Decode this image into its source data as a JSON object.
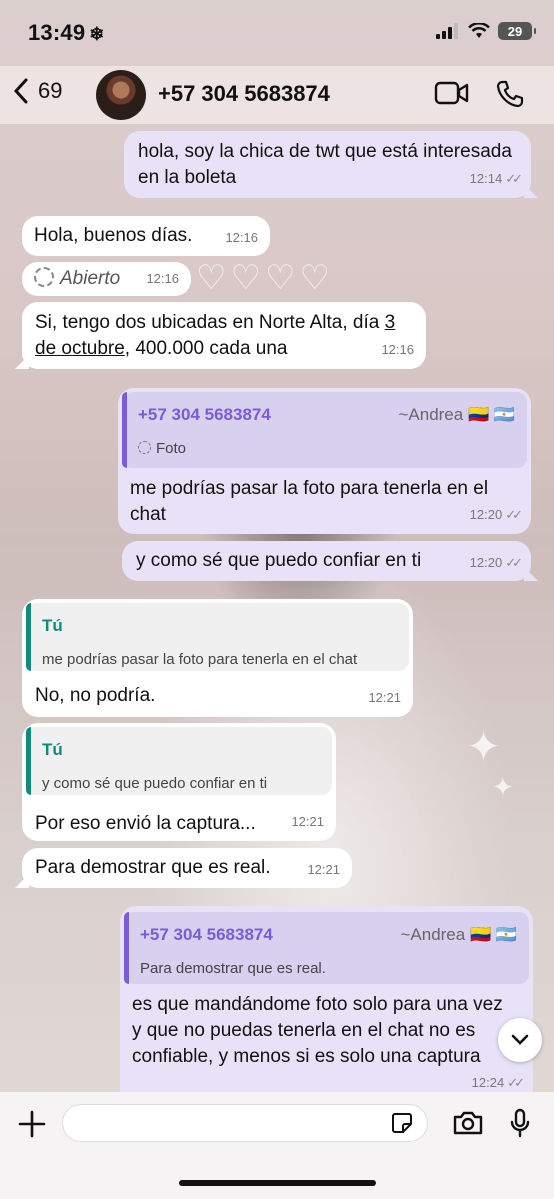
{
  "status_bar": {
    "time": "13:49",
    "battery": "29"
  },
  "header": {
    "back_count": "69",
    "contact": "+57 304 5683874"
  },
  "messages": [
    {
      "text": "hola, soy la chica de twt que está interesada en la boleta",
      "time": "12:14"
    },
    {
      "text": "Hola, buenos días.",
      "time": "12:16"
    },
    {
      "text": "Abierto",
      "time": "12:16"
    },
    {
      "text_a": "Si, tengo dos ubicadas en Norte Alta, día ",
      "text_link": "3 de octubre",
      "text_b": ", 400.000 cada una",
      "time": "12:16"
    },
    {
      "quote_name": "+57 304 5683874",
      "quote_alias": "~Andrea 🇨🇴 🇦🇷",
      "quote_text": "Foto",
      "text": "me podrías pasar la foto para tenerla en el chat",
      "time": "12:20"
    },
    {
      "text": "y como sé que puedo confiar en ti",
      "time": "12:20"
    },
    {
      "quote_name": "Tú",
      "quote_text": "me podrías pasar la foto para tenerla en el chat",
      "text": "No, no podría.",
      "time": "12:21"
    },
    {
      "quote_name": "Tú",
      "quote_text": "y como sé que puedo confiar en ti",
      "text": "Por eso envió la captura...",
      "time": "12:21"
    },
    {
      "text": "Para demostrar que es real.",
      "time": "12:21"
    },
    {
      "quote_name": "+57 304 5683874",
      "quote_alias": "~Andrea 🇨🇴 🇦🇷",
      "quote_text": "Para demostrar que es real.",
      "text": "es que mandándome foto solo para una vez y que no puedas tenerla en el chat no es confiable, y menos si es solo una captura",
      "time": "12:24"
    }
  ],
  "colors": {
    "outgoing": "#e7e2f7",
    "incoming": "#ffffff",
    "reply_accent_out": "#7b5cd6",
    "reply_accent_in": "#118a7e"
  },
  "icons": [
    "snowflake-icon",
    "signal-icon",
    "wifi-icon",
    "battery-icon",
    "back-chevron-icon",
    "video-call-icon",
    "phone-icon",
    "plus-icon",
    "sticker-icon",
    "camera-icon",
    "microphone-icon",
    "chevron-down-icon",
    "view-once-icon",
    "read-receipt-icon"
  ]
}
